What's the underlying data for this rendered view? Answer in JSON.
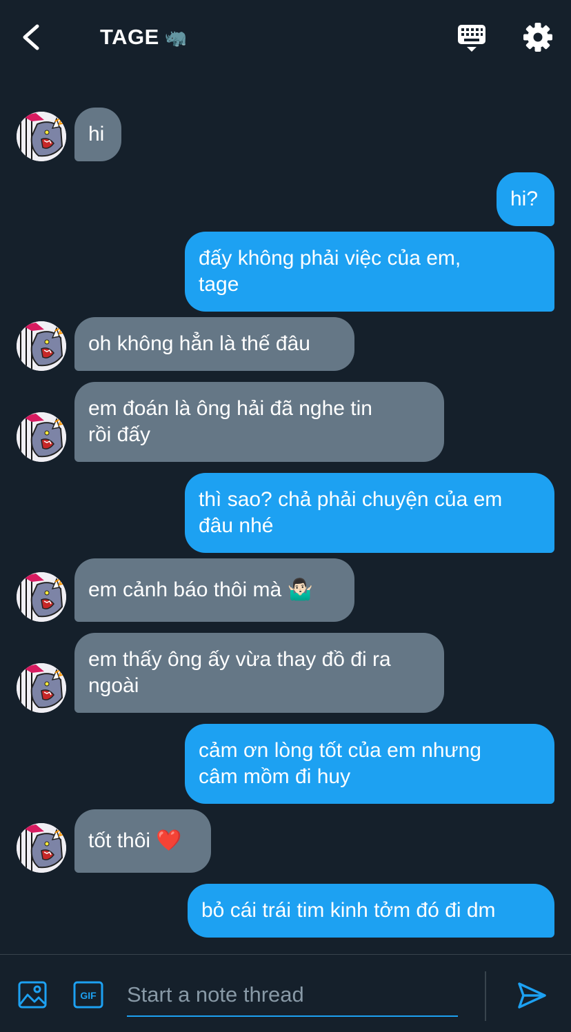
{
  "header": {
    "back_icon": "chevron-left-icon",
    "title": "TAGE",
    "title_emoji": "🦏",
    "keyboard_icon": "keyboard-icon",
    "settings_icon": "gear-icon"
  },
  "messages": [
    {
      "side": "in",
      "text": "hi",
      "avatar": true
    },
    {
      "side": "out",
      "text": "hi?"
    },
    {
      "side": "out",
      "text": "đấy không phải việc của em,\ntage"
    },
    {
      "side": "in",
      "text": "oh không hẳn là thế đâu",
      "avatar": true
    },
    {
      "side": "in",
      "text": "em đoán là ông hải đã nghe tin\nrồi đấy",
      "avatar": true
    },
    {
      "side": "out",
      "text": "thì sao? chả phải chuyện của em\nđâu nhé"
    },
    {
      "side": "in",
      "text": "em cảnh báo thôi mà 🤷🏻‍♂️",
      "avatar": true
    },
    {
      "side": "in",
      "text": "em thấy ông ấy vừa thay đồ đi ra\nngoài",
      "avatar": true
    },
    {
      "side": "out",
      "text": "cảm ơn lòng tốt của em nhưng\ncâm mồm đi huy"
    },
    {
      "side": "in",
      "text": "tốt thôi ❤️",
      "avatar": true
    },
    {
      "side": "out",
      "text": "bỏ cái trái tim kinh tởm đó đi dm"
    }
  ],
  "compose": {
    "placeholder": "Start a note thread",
    "media_icon": "image-icon",
    "gif_label": "GIF",
    "send_icon": "send-icon"
  },
  "colors": {
    "background": "#15202b",
    "incoming_bubble": "#657786",
    "outgoing_bubble": "#1da1f2",
    "accent": "#1da1f2",
    "placeholder": "#8899a6",
    "divider": "#38444d"
  }
}
